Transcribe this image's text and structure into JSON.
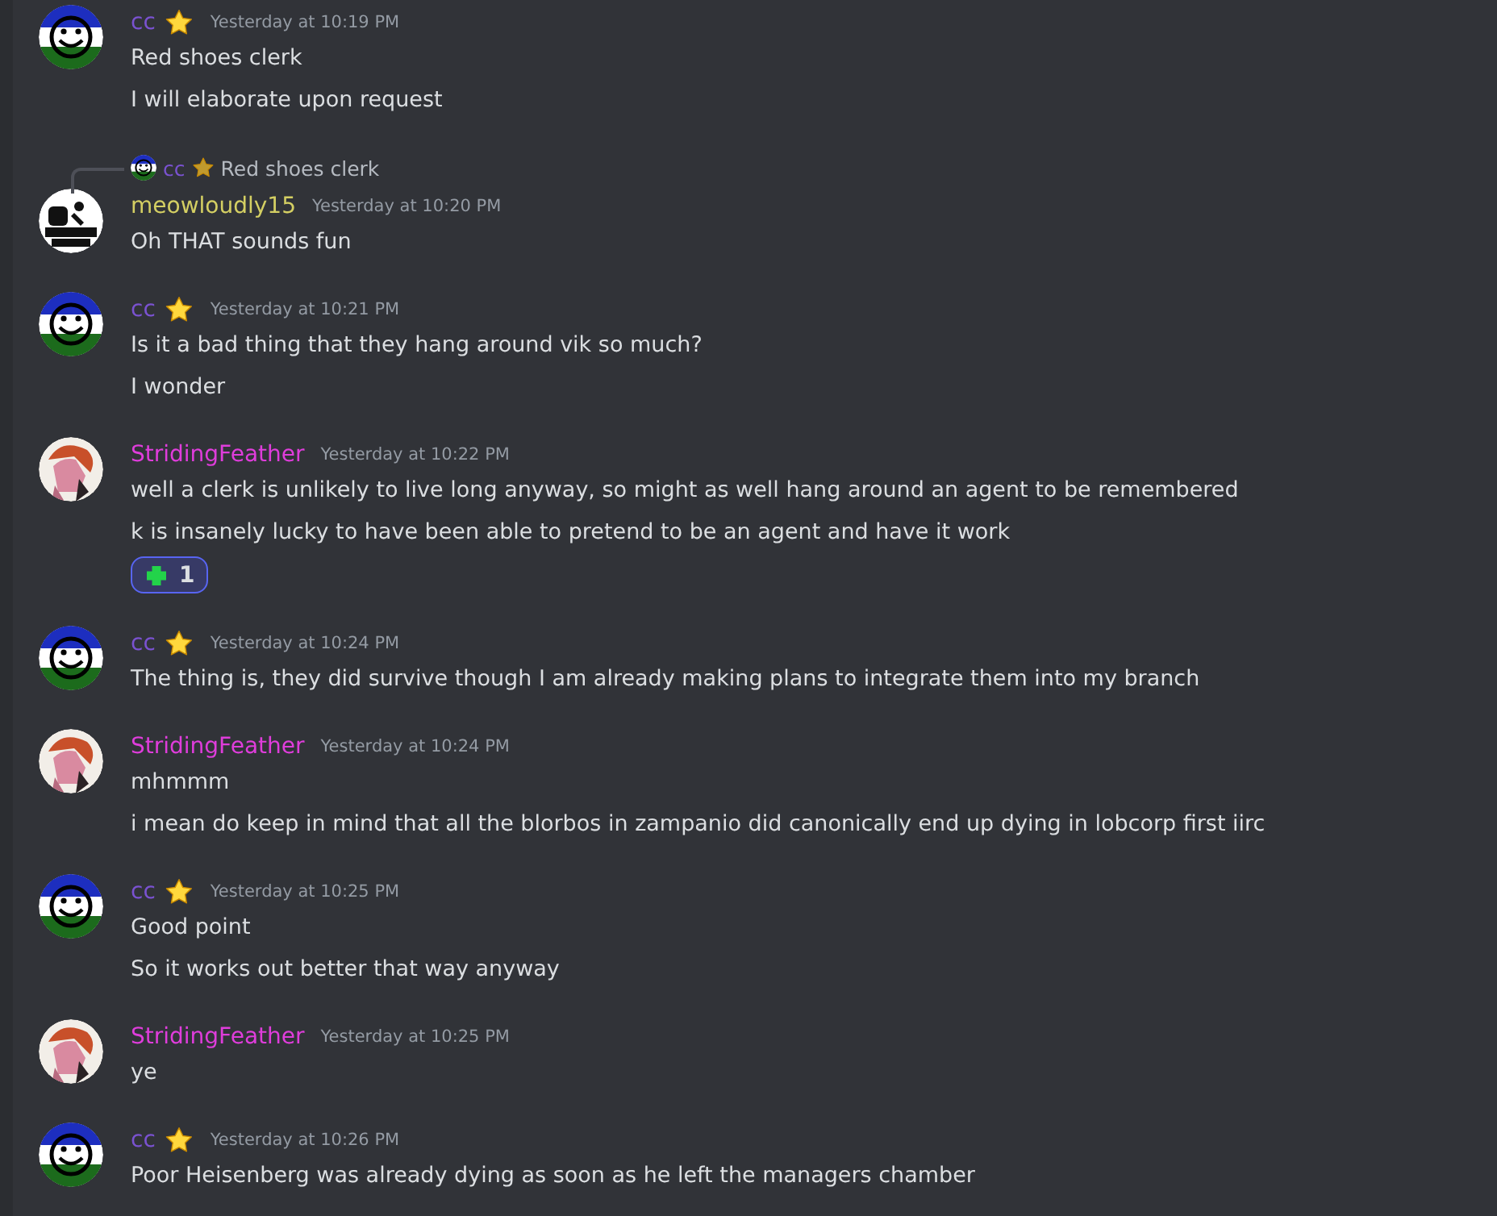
{
  "messages": [
    {
      "author": "cc",
      "color": "#7a52d0",
      "role_icon": true,
      "time": "Yesterday at 10:19 PM",
      "lines": [
        "Red shoes clerk",
        "I will elaborate upon request"
      ]
    },
    {
      "author": "meowloudly15",
      "color": "#d4cf63",
      "role_icon": false,
      "time": "Yesterday at 10:20 PM",
      "reply": {
        "author": "cc",
        "color": "#7a52d0",
        "role_icon": true,
        "text": "Red shoes clerk"
      },
      "lines": [
        "Oh THAT sounds fun"
      ]
    },
    {
      "author": "cc",
      "color": "#7a52d0",
      "role_icon": true,
      "time": "Yesterday at 10:21 PM",
      "lines": [
        "Is it a bad thing that they hang around vik so much?",
        "I wonder"
      ]
    },
    {
      "author": "StridingFeather",
      "color": "#df3ddb",
      "role_icon": false,
      "time": "Yesterday at 10:22 PM",
      "lines": [
        "well a clerk is unlikely to live long anyway, so might as well hang around an agent to be remembered",
        "k is insanely lucky to have been able to pretend to be an agent and have it work"
      ],
      "reactions": [
        {
          "count": "1",
          "selected": true
        }
      ]
    },
    {
      "author": "cc",
      "color": "#7a52d0",
      "role_icon": true,
      "time": "Yesterday at 10:24 PM",
      "lines": [
        "The thing is, they did survive though I am already making plans to integrate them into my branch"
      ]
    },
    {
      "author": "StridingFeather",
      "color": "#df3ddb",
      "role_icon": false,
      "time": "Yesterday at 10:24 PM",
      "lines": [
        "mhmmm",
        "i mean do keep in mind that all the blorbos in zampanio did canonically end up dying in lobcorp first iirc"
      ]
    },
    {
      "author": "cc",
      "color": "#7a52d0",
      "role_icon": true,
      "time": "Yesterday at 10:25 PM",
      "lines": [
        "Good point",
        "So it works out better that way anyway"
      ]
    },
    {
      "author": "StridingFeather",
      "color": "#df3ddb",
      "role_icon": false,
      "time": "Yesterday at 10:25 PM",
      "lines": [
        "ye"
      ]
    },
    {
      "author": "cc",
      "color": "#7a52d0",
      "role_icon": true,
      "time": "Yesterday at 10:26 PM",
      "lines": [
        "Poor Heisenberg was already dying as soon as he left the managers chamber"
      ]
    }
  ]
}
